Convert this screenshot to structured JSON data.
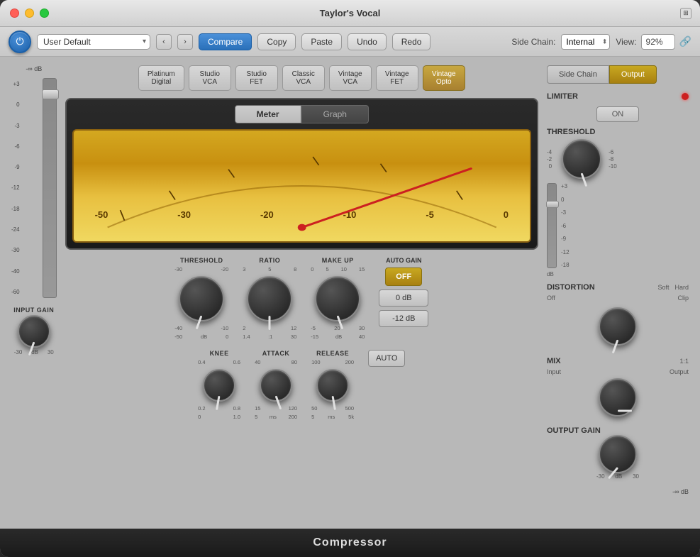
{
  "window": {
    "title": "Taylor's Vocal"
  },
  "toolbar": {
    "preset": "User Default",
    "compare": "Compare",
    "copy": "Copy",
    "paste": "Paste",
    "undo": "Undo",
    "redo": "Redo"
  },
  "sidechain": {
    "label": "Side Chain:",
    "value": "Internal"
  },
  "view": {
    "label": "View:",
    "value": "92%"
  },
  "compressor_types": [
    {
      "id": "platinum_digital",
      "label": "Platinum\nDigital",
      "active": false
    },
    {
      "id": "studio_vca",
      "label": "Studio\nVCA",
      "active": false
    },
    {
      "id": "studio_fet",
      "label": "Studio\nFET",
      "active": false
    },
    {
      "id": "classic_vca",
      "label": "Classic\nVCA",
      "active": false
    },
    {
      "id": "vintage_vca",
      "label": "Vintage\nVCA",
      "active": false
    },
    {
      "id": "vintage_fet",
      "label": "Vintage\nFET",
      "active": false
    },
    {
      "id": "vintage_opto",
      "label": "Vintage\nOpto",
      "active": true
    }
  ],
  "meter": {
    "meter_tab": "Meter",
    "graph_tab": "Graph",
    "marks": [
      "-50",
      "-30",
      "-20",
      "-10",
      "-5",
      "0"
    ]
  },
  "controls": {
    "threshold": {
      "label": "THRESHOLD",
      "marks_top": [
        "-30",
        "-20"
      ],
      "marks_bottom": [
        "-40",
        "-10"
      ],
      "db_mark": "dB",
      "min": "-50",
      "max": "0"
    },
    "ratio": {
      "label": "RATIO",
      "marks_top": [
        "3",
        "5",
        "8"
      ],
      "marks_bottom": [
        "2",
        "12"
      ],
      "sub": ":1",
      "min": "1.4",
      "max": "30"
    },
    "makeup": {
      "label": "MAKE UP",
      "marks_top": [
        "0",
        "5",
        "10",
        "15"
      ],
      "marks_bottom": [
        "-5",
        "20",
        "30"
      ],
      "db_mark": "dB",
      "min": "-15",
      "max": "40"
    },
    "knee": {
      "label": "KNEE",
      "marks_top": [
        "0.4",
        "0.6"
      ],
      "marks_bottom": [
        "0.2",
        "0.8"
      ],
      "min": "0",
      "max": "1.0"
    },
    "attack": {
      "label": "ATTACK",
      "marks_top": [
        "40",
        "80"
      ],
      "marks_bottom": [
        "15",
        "120"
      ],
      "ms": "ms",
      "min": "5",
      "max": "200"
    },
    "release": {
      "label": "RELEASE",
      "marks_top": [
        "100",
        "200"
      ],
      "marks_bottom": [
        "50",
        "500"
      ],
      "ms": "ms",
      "min": "5",
      "max": "5k"
    }
  },
  "auto_gain": {
    "label": "AUTO GAIN",
    "off_btn": "OFF",
    "db0_btn": "0 dB",
    "db12_btn": "-12 dB",
    "auto_btn": "AUTO"
  },
  "right_panel": {
    "sc_tab": "Side Chain",
    "output_tab": "Output",
    "limiter": {
      "label": "LIMITER",
      "on_btn": "ON"
    },
    "threshold": {
      "label": "THRESHOLD",
      "marks": [
        "-4",
        "-2",
        "0"
      ],
      "sub_marks": [
        "-6",
        "-8",
        "-10"
      ],
      "db_label": "dB"
    },
    "distortion": {
      "label": "DISTORTION",
      "soft": "Soft",
      "hard": "Hard",
      "off": "Off",
      "clip": "Clip"
    },
    "mix": {
      "label": "MIX",
      "ratio": "1:1",
      "input": "Input",
      "output": "Output"
    },
    "output_gain": {
      "label": "OUTPUT GAIN",
      "min": "-30",
      "max": "30",
      "db": "dB"
    }
  },
  "input_gain": {
    "label": "INPUT GAIN",
    "inf": "-∞ dB",
    "marks": [
      "+3",
      "0",
      "-3",
      "-6",
      "-9",
      "-12",
      "-18",
      "-24",
      "-30",
      "-40",
      "-60"
    ],
    "min": "-30",
    "max": "30",
    "db": "dB"
  },
  "bottom": {
    "label": "Compressor"
  }
}
